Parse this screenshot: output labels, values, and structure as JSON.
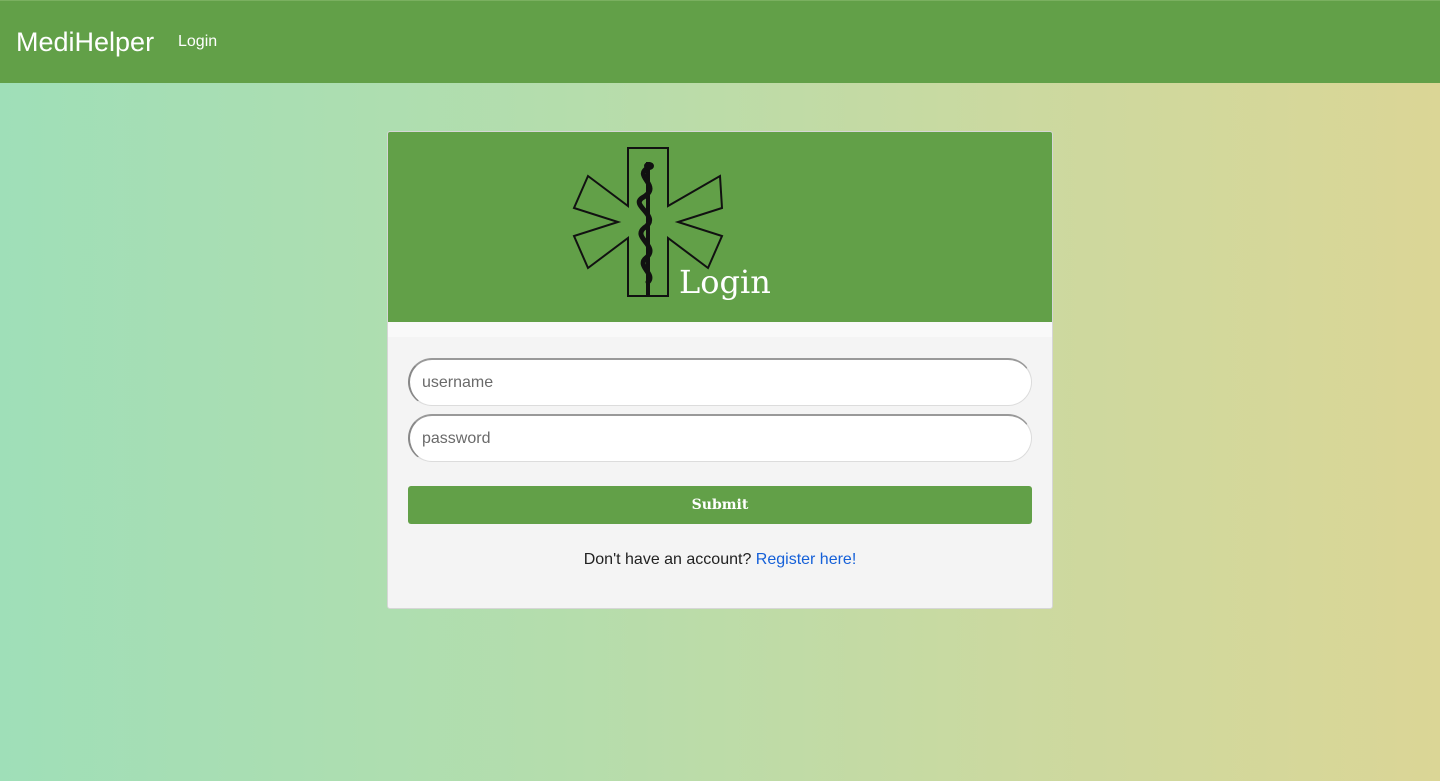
{
  "navbar": {
    "brand": "MediHelper",
    "login_link": "Login",
    "color": "#62a048"
  },
  "card": {
    "title": "Login",
    "logo_icon": "star-of-life-icon",
    "username_placeholder": "username",
    "password_placeholder": "password",
    "submit_label": "Submit",
    "register_prompt": "Don't have an account?",
    "register_link": "Register here!",
    "accent_color": "#62a048",
    "link_color": "#1560d8"
  }
}
